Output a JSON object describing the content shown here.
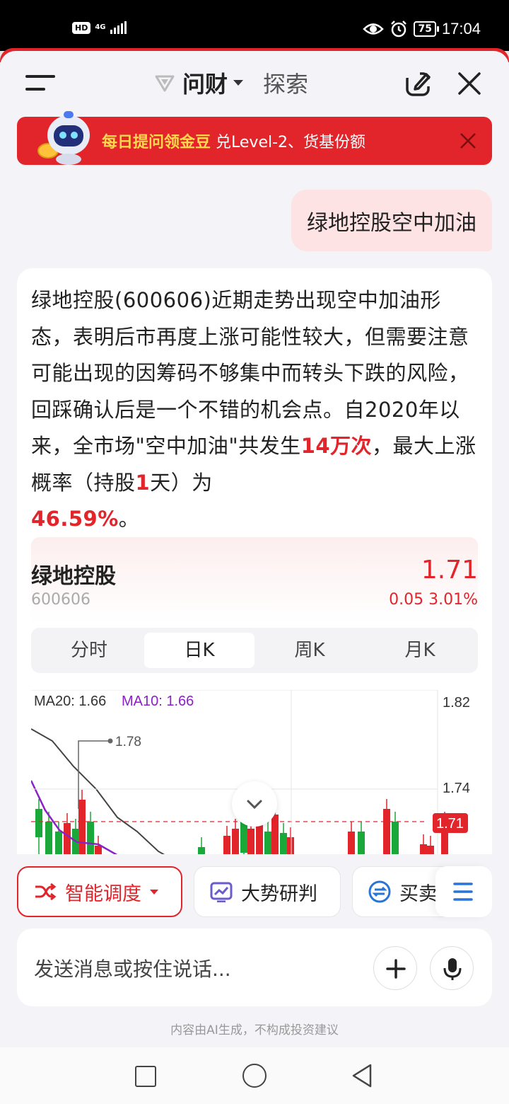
{
  "status_bar": {
    "hd": "HD",
    "network": "4G",
    "battery": "75",
    "time": "17:04"
  },
  "header": {
    "title": "问财",
    "explore": "探索"
  },
  "banner": {
    "highlight": "每日提问领金豆",
    "rest": "兑Level-2、货基份额"
  },
  "user_message": "绿地控股空中加油",
  "ai_answer": {
    "text_1": "绿地控股(600606)近期走势出现空中加油形态，表明后市再度上涨可能性较大，但需要注意可能出现的因筹码不够集中而转头下跌的风险，回踩确认后是一个不错的机会点。自2020年以来，全市场\"空中加油\"共发生",
    "hl_count": "14万次",
    "text_2": "，最大上涨概率（持股",
    "hl_days": "1",
    "text_3": "天）为",
    "hl_prob": "46.59%",
    "text_4": "。"
  },
  "quote": {
    "name": "绿地控股",
    "code": "600606",
    "price": "1.71",
    "change": "0.05 3.01%"
  },
  "tabs": [
    "分时",
    "日K",
    "周K",
    "月K"
  ],
  "active_tab": "日K",
  "chart_data": {
    "type": "candlestick",
    "legend_ma20": "MA20: 1.66",
    "legend_ma10": "MA10: 1.66",
    "y_ticks": [
      "1.82",
      "1.74"
    ],
    "current_price_tag": "1.71",
    "high_annotation": "1.78",
    "ylim": [
      1.62,
      1.84
    ],
    "current_price": 1.71,
    "ma10_color": "#8b1fc8",
    "ma20_color": "#444444",
    "up_color": "#e2242b",
    "down_color": "#1aa83a"
  },
  "chips": {
    "smart": "智能调度",
    "trend": "大势研判",
    "buy": "买卖"
  },
  "input": {
    "placeholder": "发送消息或按住说话..."
  },
  "disclaimer": "内容由AI生成，不构成投资建议",
  "colors": {
    "accent_red": "#e2242b",
    "gold": "#ffd84d"
  }
}
